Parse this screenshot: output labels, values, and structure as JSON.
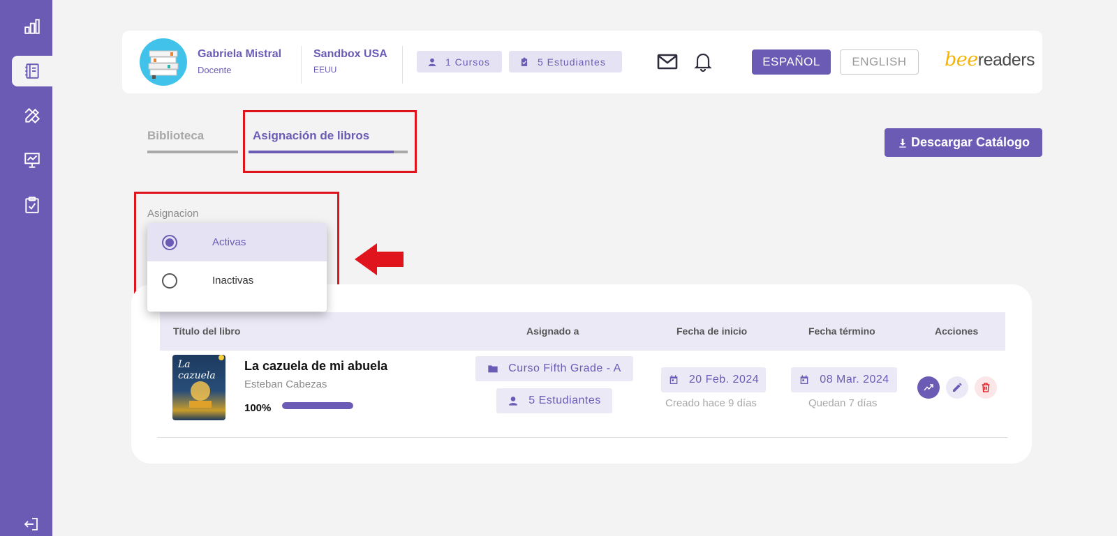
{
  "colors": {
    "brand": "#6b5bb5",
    "brand_light": "#e5e2f3",
    "danger": "#e0141c",
    "background": "#f3f3f4"
  },
  "sidebar": {
    "items": [
      {
        "icon": "bar-chart-icon"
      },
      {
        "icon": "notebook-icon",
        "active": true
      },
      {
        "icon": "pencil-ruler-icon"
      },
      {
        "icon": "presentation-chart-icon"
      },
      {
        "icon": "clipboard-check-icon"
      }
    ],
    "logout_icon": "logout-icon"
  },
  "header": {
    "user_name": "Gabriela Mistral",
    "user_role": "Docente",
    "school_name": "Sandbox USA",
    "school_country": "EEUU",
    "courses_pill": "1 Cursos",
    "students_pill": "5 Estudiantes",
    "mail_icon": "mail-icon",
    "bell_icon": "bell-icon",
    "lang_es": "ESPAÑOL",
    "lang_en": "ENGLISH",
    "logo_bee": "bee",
    "logo_readers": "readers"
  },
  "tabs": [
    {
      "label": "Biblioteca",
      "active": false
    },
    {
      "label": "Asignación de libros",
      "active": true
    }
  ],
  "download_button": "Descargar Catálogo",
  "filter": {
    "label": "Asignacion",
    "options": [
      {
        "label": "Activas",
        "selected": true
      },
      {
        "label": "Inactivas",
        "selected": false
      }
    ]
  },
  "table": {
    "headers": {
      "title": "Título del libro",
      "assigned": "Asignado a",
      "start": "Fecha de inicio",
      "end": "Fecha término",
      "actions": "Acciones"
    },
    "rows": [
      {
        "cover_text": "La cazuela",
        "title": "La cazuela de mi abuela",
        "author": "Esteban Cabezas",
        "progress_label": "100%",
        "progress": 1.0,
        "course": "Curso Fifth Grade - A",
        "students": "5 Estudiantes",
        "start_date": "20 Feb. 2024",
        "start_note": "Creado hace 9 días",
        "end_date": "08 Mar. 2024",
        "end_note": "Quedan 7 días"
      }
    ]
  }
}
